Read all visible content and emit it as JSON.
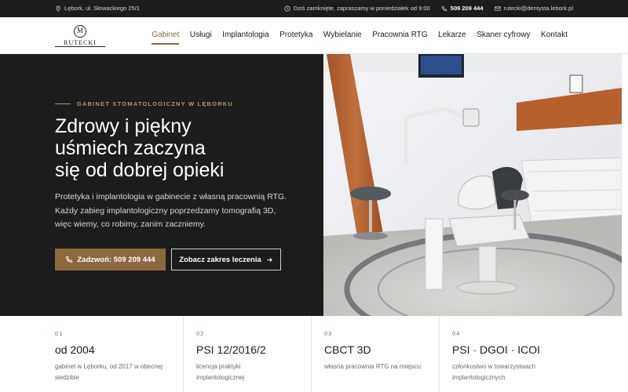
{
  "topbar": {
    "address": "Lębork, ul. Słowackiego 25/1",
    "hours": "Dziś zamknięte, zapraszamy w poniedziałek od 9:00",
    "phone": "509 209 444",
    "email": "rutecki@dentysta.lebork.pl",
    "icons": [
      "location-pin-icon",
      "clock-icon",
      "phone-icon",
      "mail-icon"
    ]
  },
  "logo": {
    "mark": "M",
    "text": "RUTECKI"
  },
  "nav": {
    "items": [
      {
        "label": "Gabinet",
        "active": true
      },
      {
        "label": "Usługi"
      },
      {
        "label": "Implantologia"
      },
      {
        "label": "Protetyka"
      },
      {
        "label": "Wybielanie"
      },
      {
        "label": "Pracownia RTG"
      },
      {
        "label": "Lekarze"
      },
      {
        "label": "Skaner cyfrowy"
      },
      {
        "label": "Kontakt"
      }
    ]
  },
  "hero": {
    "eyebrow": "GABINET STOMATOLOGICZNY W LĘBORKU",
    "headline_1": "Zdrowy i piękny",
    "headline_2": "uśmiech zaczyna",
    "headline_3": "się od dobrej opieki",
    "lead_1": "Protetyka i implantologia w gabinecie z własną pracownią RTG.",
    "lead_2": "Każdy zabieg implantologiczny poprzedzamy tomografią 3D,",
    "lead_3": "więc wiemy, co robimy, zanim zaczniemy.",
    "cta_primary": "Zadzwoń: 509 209 444",
    "cta_secondary": "Zobacz zakres leczenia"
  },
  "stats": [
    {
      "num": "01",
      "title": "od 2004",
      "desc": "gabinet w Lęborku, od 2017 w obecnej siedzibie"
    },
    {
      "num": "02",
      "title": "PSI 12/2016/2",
      "desc": "licencja praktyki implantologicznej"
    },
    {
      "num": "03",
      "title": "CBCT 3D",
      "desc": "własna pracownia RTG na miejscu"
    },
    {
      "num": "04",
      "title": "PSI · DGOI · ICOI",
      "desc": "członkostwo w towarzystwach implantologicznych"
    }
  ],
  "colors": {
    "accent": "#8a6a3d",
    "dark": "#1c1c1c",
    "eyebrow": "#b29566"
  }
}
